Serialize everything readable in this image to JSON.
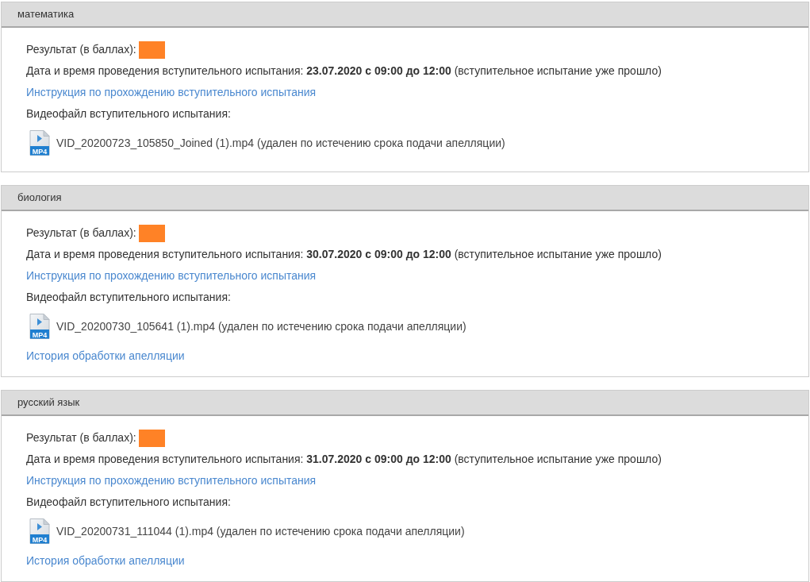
{
  "sections": [
    {
      "title": "математика",
      "result_label": "Результат (в баллах):",
      "result_redacted": true,
      "date_line": "Дата и время проведения вступительного испытания: **23.07.2020 с 09:00 до 12:00** (вступительное испытание уже прошло)",
      "instruction_link": "Инструкция по прохождению вступительного испытания",
      "video_label": "Видеофайл вступительного испытания:",
      "video_file": {
        "icon_label": "MP4",
        "text": "VID_20200723_105850_Joined (1).mp4 (удален по истечению срока подачи апелляции)"
      }
    },
    {
      "title": "биология",
      "result_label": "Результат (в баллах):",
      "result_redacted": true,
      "date_line": "Дата и время проведения вступительного испытания: **30.07.2020 с 09:00 до 12:00** (вступительное испытание уже прошло)",
      "instruction_link": "Инструкция по прохождению вступительного испытания",
      "video_label": "Видеофайл вступительного испытания:",
      "video_file": {
        "icon_label": "MP4",
        "text": "VID_20200730_105641 (1).mp4 (удален по истечению срока подачи апелляции)"
      },
      "appeal_history_link": "История обработки апелляции"
    },
    {
      "title": "русский язык",
      "result_label": "Результат (в баллах):",
      "result_redacted": true,
      "date_line": "Дата и время проведения вступительного испытания: **31.07.2020 с 09:00 до 12:00** (вступительное испытание уже прошло)",
      "instruction_link": "Инструкция по прохождению вступительного испытания",
      "video_label": "Видеофайл вступительного испытания:",
      "video_file": {
        "icon_label": "MP4",
        "text": "VID_20200731_111044 (1).mp4 (удален по истечению срока подачи апелляции)"
      },
      "appeal_history_link": "История обработки апелляции"
    }
  ]
}
